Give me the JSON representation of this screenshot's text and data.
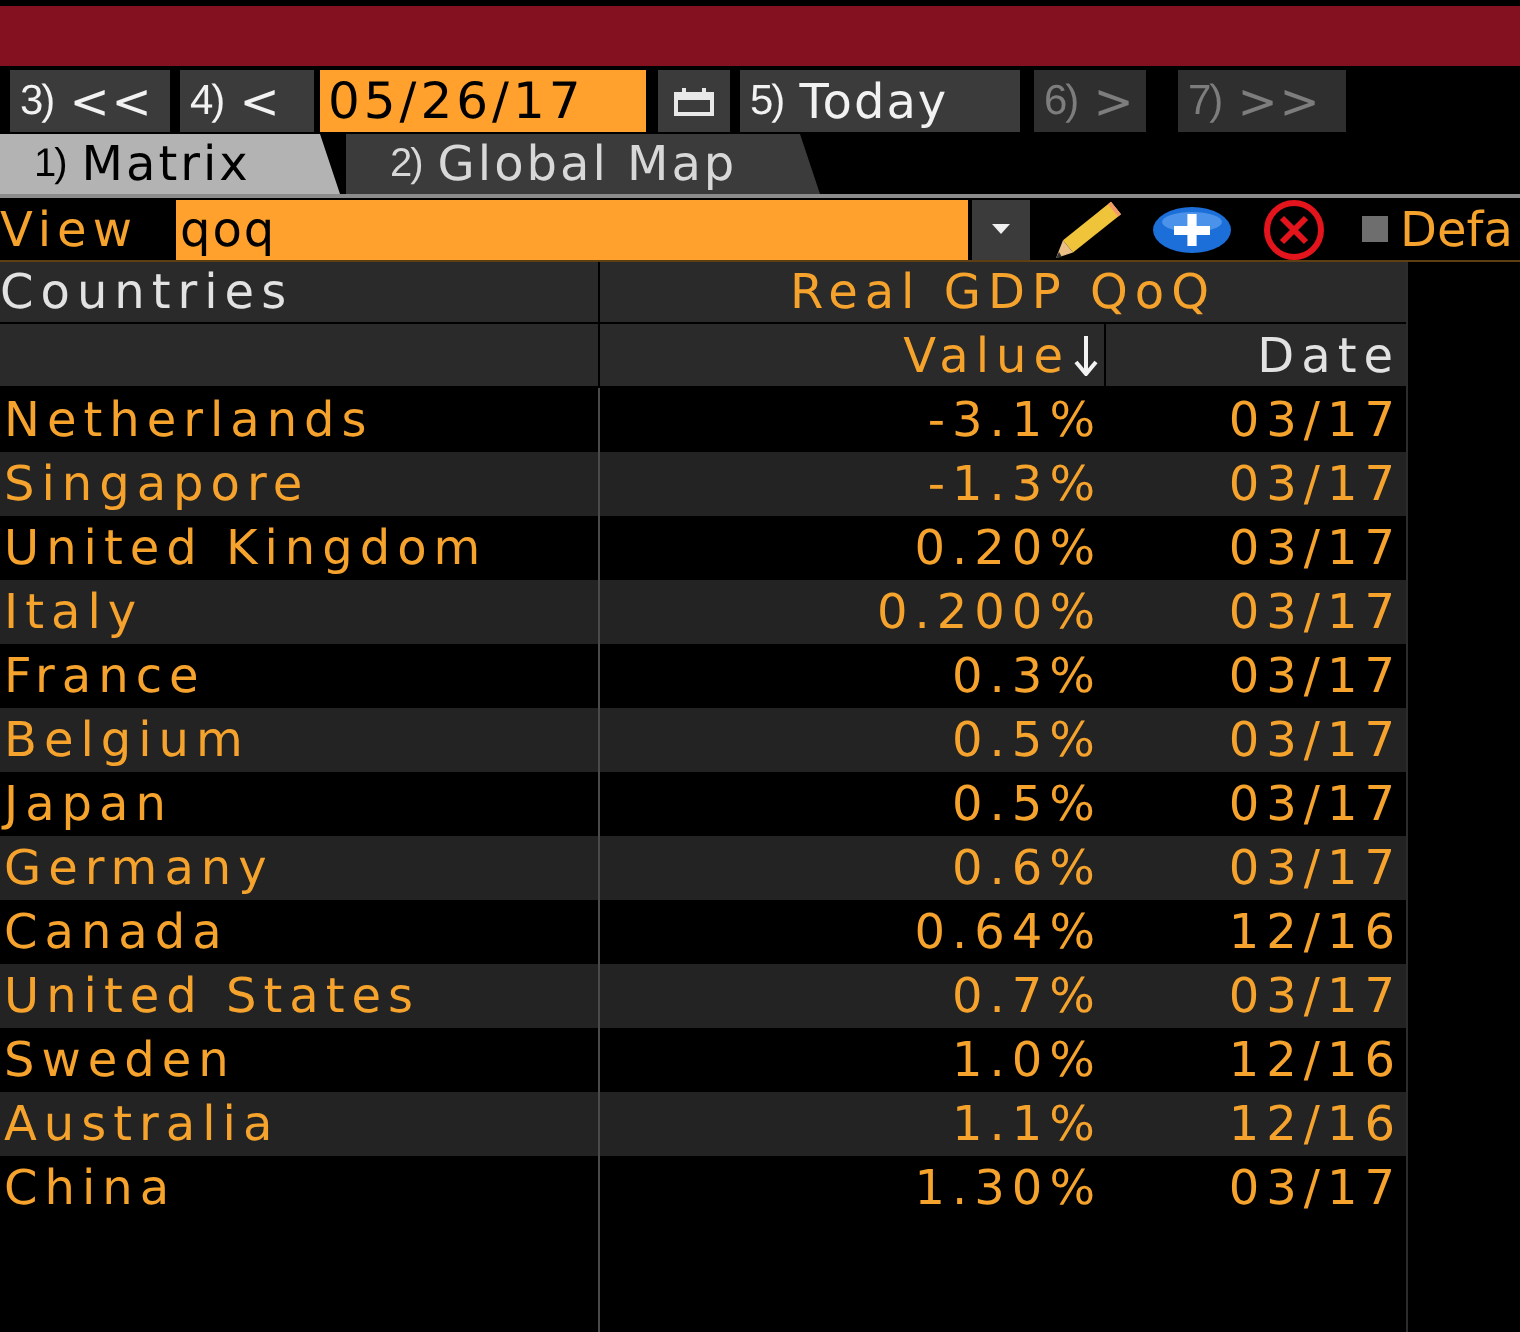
{
  "navigation": [
    {
      "kind": "button",
      "number": "3)",
      "label": "<<",
      "disabled": false
    },
    {
      "kind": "button",
      "number": "4)",
      "label": "<",
      "disabled": false
    },
    {
      "kind": "date",
      "value": "05/26/17"
    },
    {
      "kind": "calendar"
    },
    {
      "kind": "button",
      "number": "5)",
      "label": "Today",
      "disabled": false
    },
    {
      "kind": "button",
      "number": "6)",
      "label": ">",
      "disabled": true
    },
    {
      "kind": "button",
      "number": "7)",
      "label": ">>",
      "disabled": true
    }
  ],
  "tabs": [
    {
      "number": "1)",
      "label": "Matrix",
      "selected": true
    },
    {
      "number": "2)",
      "label": "Global Map",
      "selected": false
    }
  ],
  "view": {
    "label": "View",
    "value": "qoq",
    "default_option": {
      "label": "Defa",
      "checked": false
    }
  },
  "table": {
    "columns": [
      {
        "label": "Countries",
        "sorted": false
      },
      {
        "label": "Real GDP QoQ",
        "subcolumns": [
          {
            "label": "Value",
            "sorted": true
          },
          {
            "label": "Date",
            "sorted": false
          }
        ]
      }
    ],
    "rows": [
      {
        "country": "Netherlands",
        "value": "-3.1%",
        "date": "03/17"
      },
      {
        "country": "Singapore",
        "value": "-1.3%",
        "date": "03/17"
      },
      {
        "country": "United Kingdom",
        "value": "0.20%",
        "date": "03/17"
      },
      {
        "country": "Italy",
        "value": "0.200%",
        "date": "03/17"
      },
      {
        "country": "France",
        "value": "0.3%",
        "date": "03/17"
      },
      {
        "country": "Belgium",
        "value": "0.5%",
        "date": "03/17"
      },
      {
        "country": "Japan",
        "value": "0.5%",
        "date": "03/17"
      },
      {
        "country": "Germany",
        "value": "0.6%",
        "date": "03/17"
      },
      {
        "country": "Canada",
        "value": "0.64%",
        "date": "12/16"
      },
      {
        "country": "United States",
        "value": "0.7%",
        "date": "03/17"
      },
      {
        "country": "Sweden",
        "value": "1.0%",
        "date": "12/16"
      },
      {
        "country": "Australia",
        "value": "1.1%",
        "date": "12/16"
      },
      {
        "country": "China",
        "value": "1.30%",
        "date": "03/17"
      }
    ]
  }
}
